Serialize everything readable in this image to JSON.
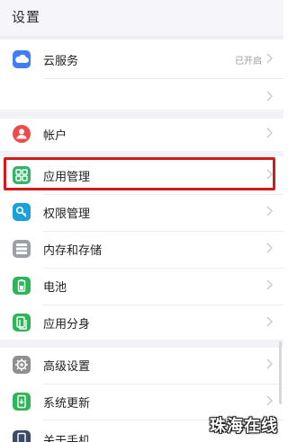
{
  "header": {
    "title": "设置"
  },
  "rows": [
    {
      "label": "云服务",
      "status": "已开启",
      "icon": "cloud-icon",
      "color": "#3f7ff0"
    },
    {
      "label": "",
      "status": "",
      "icon": "",
      "color": ""
    },
    {
      "label": "帐户",
      "status": "",
      "icon": "account-icon",
      "color": "#ef4b4b"
    },
    {
      "label": "应用管理",
      "status": "",
      "icon": "app-manage-icon",
      "color": "#35b36b"
    },
    {
      "label": "权限管理",
      "status": "",
      "icon": "permission-icon",
      "color": "#1aa1d9"
    },
    {
      "label": "内存和存储",
      "status": "",
      "icon": "storage-icon",
      "color": "#9aa0a6"
    },
    {
      "label": "电池",
      "status": "",
      "icon": "battery-icon",
      "color": "#2fb559"
    },
    {
      "label": "应用分身",
      "status": "",
      "icon": "app-twin-icon",
      "color": "#2fb559"
    },
    {
      "label": "高级设置",
      "status": "",
      "icon": "gear-icon",
      "color": "#8f8f8f"
    },
    {
      "label": "系统更新",
      "status": "",
      "icon": "system-update-icon",
      "color": "#2fb559"
    },
    {
      "label": "关于手机",
      "status": "",
      "icon": "phone-info-icon",
      "color": "#3b4a6b"
    }
  ],
  "watermark": "珠海在线"
}
